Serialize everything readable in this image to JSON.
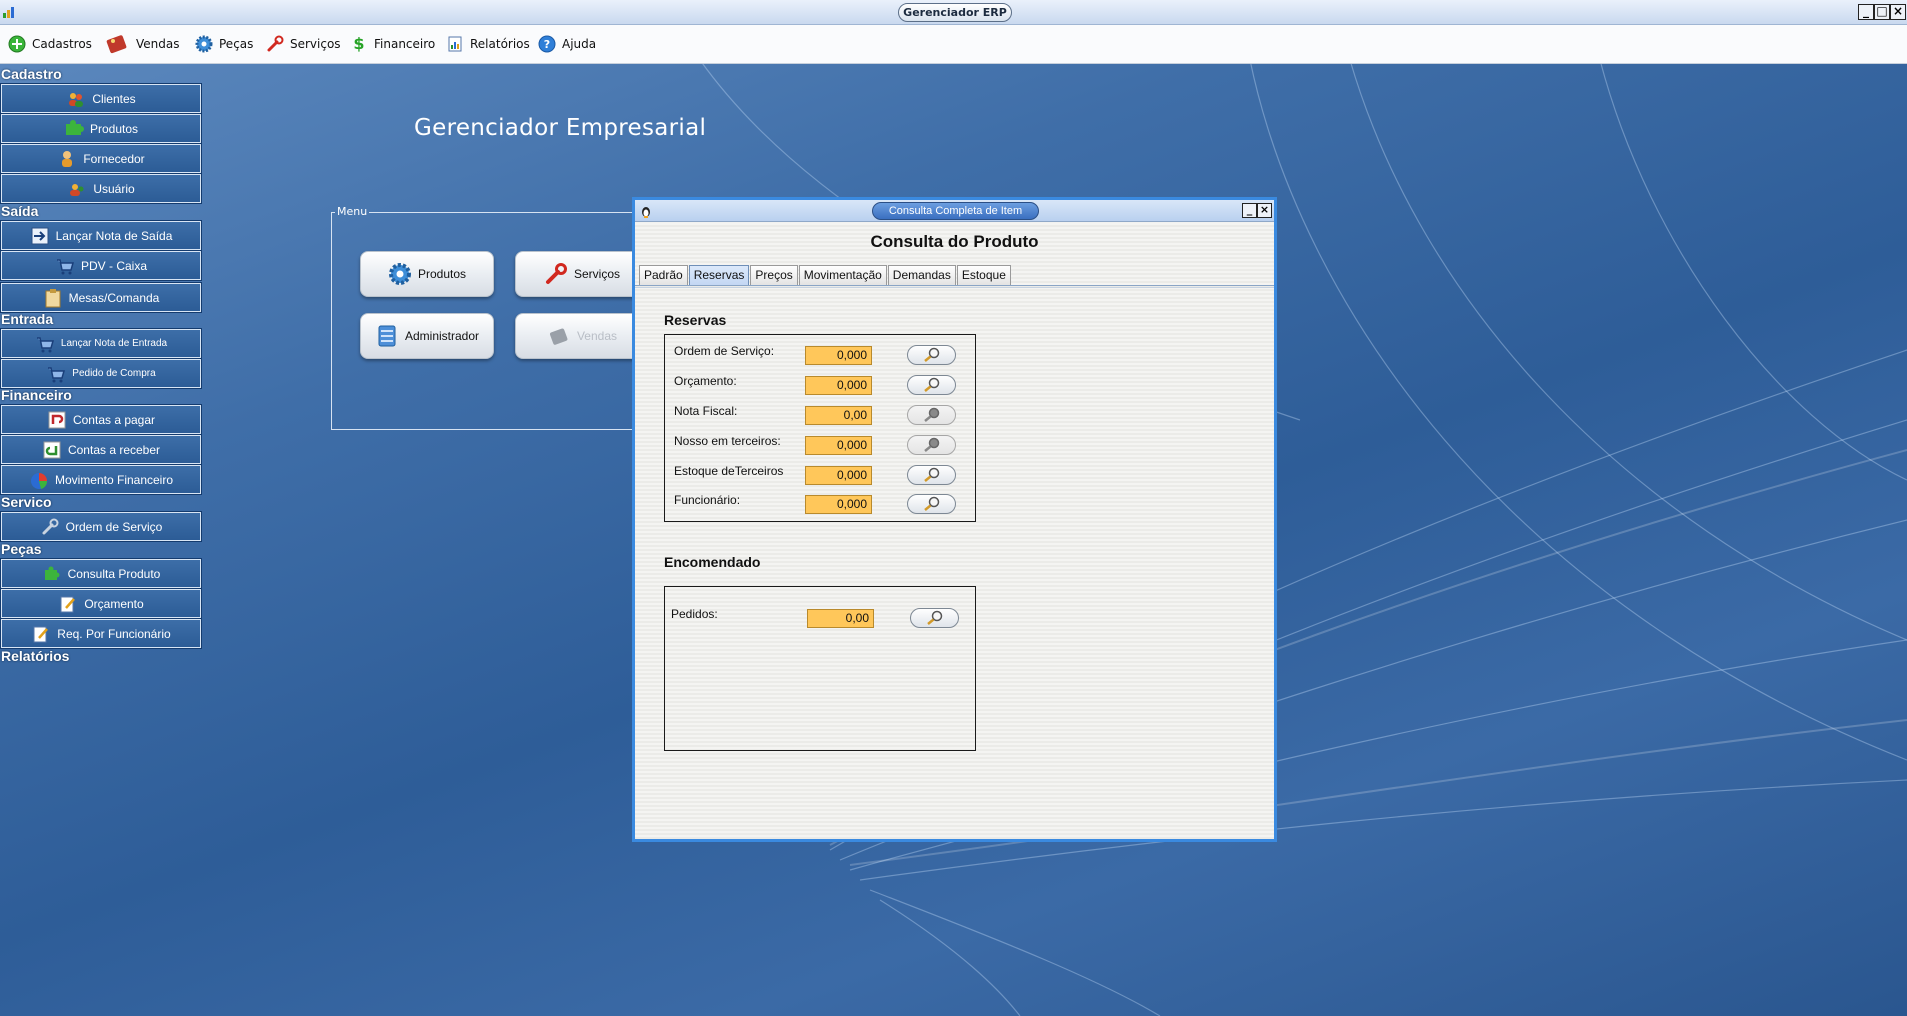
{
  "window": {
    "title": "Gerenciador ERP"
  },
  "menubar": [
    {
      "label": "Cadastros",
      "icon": "add-icon"
    },
    {
      "label": "Vendas",
      "icon": "sale-tag-icon"
    },
    {
      "label": "Peças",
      "icon": "gear-icon"
    },
    {
      "label": "Serviços",
      "icon": "wrench-icon"
    },
    {
      "label": "Financeiro",
      "icon": "dollar-icon"
    },
    {
      "label": "Relatórios",
      "icon": "report-icon"
    },
    {
      "label": "Ajuda",
      "icon": "help-icon"
    }
  ],
  "sidebar": {
    "groups": [
      {
        "title": "Cadastro",
        "items": [
          "Clientes",
          "Produtos",
          "Fornecedor",
          "Usuário"
        ]
      },
      {
        "title": "Saída",
        "items": [
          "Lançar Nota de Saída",
          "PDV - Caixa",
          "Mesas/Comanda"
        ]
      },
      {
        "title": "Entrada",
        "items": [
          "Lançar Nota de Entrada",
          "Pedido de Compra"
        ]
      },
      {
        "title": "Financeiro",
        "items": [
          "Contas a pagar",
          "Contas a receber",
          "Movimento Financeiro"
        ]
      },
      {
        "title": "Servico",
        "items": [
          "Ordem de Serviço"
        ]
      },
      {
        "title": "Peças",
        "items": [
          "Consulta Produto",
          "Orçamento",
          "Req. Por Funcionário"
        ]
      },
      {
        "title": "Relatórios",
        "items": []
      }
    ]
  },
  "header": {
    "title": "Gerenciador Empresarial"
  },
  "menu_panel": {
    "legend": "Menu",
    "buttons": [
      {
        "label": "Produtos",
        "icon": "gear-icon",
        "enabled": true
      },
      {
        "label": "Serviços",
        "icon": "wrench-icon",
        "enabled": true
      },
      {
        "label": "Administrador",
        "icon": "database-icon",
        "enabled": true
      },
      {
        "label": "Vendas",
        "icon": "sale-tag-icon",
        "enabled": false
      }
    ]
  },
  "consulta": {
    "window_title": "Consulta Completa de Item",
    "heading": "Consulta do Produto",
    "tabs": [
      "Padrão",
      "Reservas",
      "Preços",
      "Movimentação",
      "Demandas",
      "Estoque"
    ],
    "active_tab": "Reservas",
    "reservas": {
      "title": "Reservas",
      "rows": [
        {
          "label": "Ordem de Serviço:",
          "value": "0,000",
          "search_enabled": true
        },
        {
          "label": "Orçamento:",
          "value": "0,000",
          "search_enabled": true
        },
        {
          "label": "Nota Fiscal:",
          "value": "0,00",
          "search_enabled": false
        },
        {
          "label": "Nosso em terceiros:",
          "value": "0,000",
          "search_enabled": false
        },
        {
          "label": "Estoque deTerceiros",
          "value": "0,000",
          "search_enabled": true
        },
        {
          "label": "Funcionário:",
          "value": "0,000",
          "search_enabled": true
        }
      ]
    },
    "encomendado": {
      "title": "Encomendado",
      "rows": [
        {
          "label": "Pedidos:",
          "value": "0,00",
          "search_enabled": true
        }
      ]
    }
  },
  "colors": {
    "desktop": "#3f6ea8",
    "field_highlight": "#ffc75a",
    "window_border": "#3a8ae0"
  }
}
